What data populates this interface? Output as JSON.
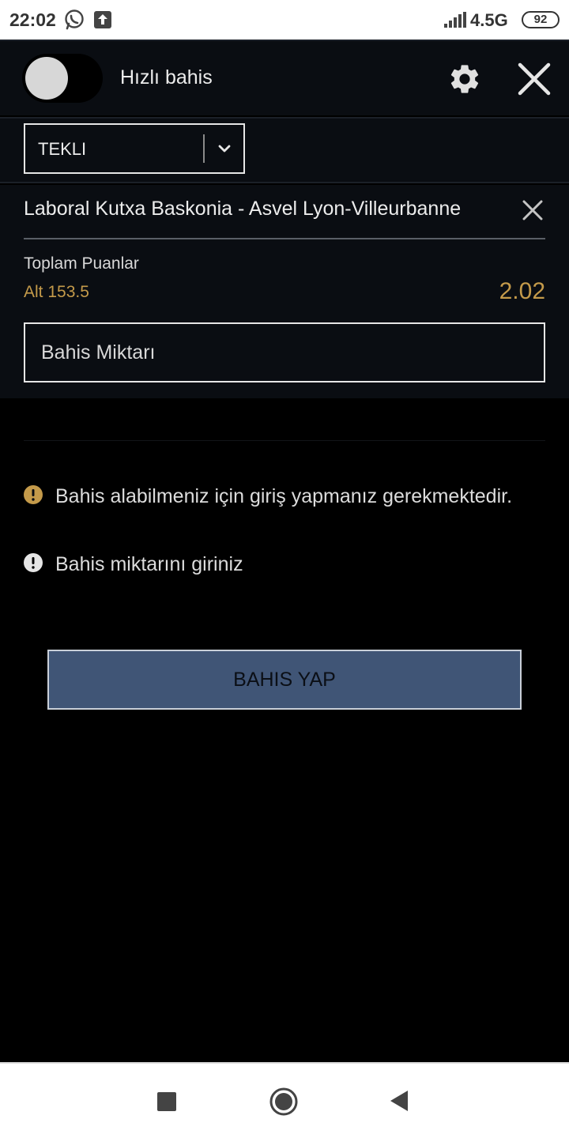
{
  "status_bar": {
    "time": "22:02",
    "network": "4.5G",
    "battery": "92",
    "icons": [
      "whatsapp-icon",
      "upload-icon",
      "signal-icon",
      "battery-icon"
    ]
  },
  "header": {
    "title": "Hızlı bahis",
    "quick_bet_enabled": false,
    "icons": [
      "gear-icon",
      "close-icon"
    ]
  },
  "bet_type": {
    "selected": "TEKLI"
  },
  "selection": {
    "match": "Laboral Kutxa Baskonia - Asvel Lyon-Villeurbanne",
    "market": "Toplam Puanlar",
    "pick": "Alt 153.5",
    "odds": "2.02"
  },
  "stake": {
    "placeholder": "Bahis Miktarı"
  },
  "messages": [
    {
      "icon": "warning-icon",
      "text": "Bahis alabilmeniz için giriş yapmanız gerekmektedir."
    },
    {
      "icon": "info-exclamation-icon",
      "text": "Bahis miktarını giriniz"
    }
  ],
  "action": {
    "place_bet": "BAHIS YAP"
  },
  "colors": {
    "accent_gold": "#c49a4a",
    "button_blue": "#405576",
    "panel": "#0a0d12"
  }
}
